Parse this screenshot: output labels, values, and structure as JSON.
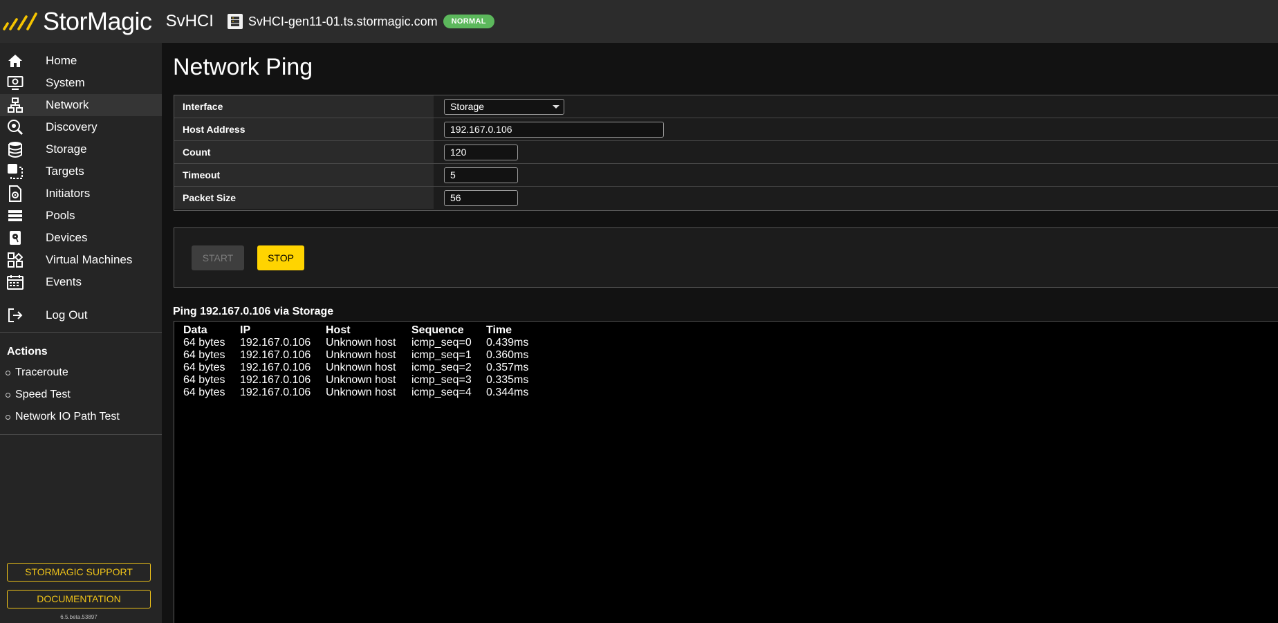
{
  "header": {
    "brand": "StorMagic",
    "product": "SvHCI",
    "hostname": "SvHCI-gen11-01.ts.stormagic.com",
    "status": "NORMAL"
  },
  "sidebar": {
    "items": [
      {
        "label": "Home",
        "icon": "home-icon"
      },
      {
        "label": "System",
        "icon": "system-icon"
      },
      {
        "label": "Network",
        "icon": "network-icon",
        "active": true
      },
      {
        "label": "Discovery",
        "icon": "discovery-icon"
      },
      {
        "label": "Storage",
        "icon": "storage-icon"
      },
      {
        "label": "Targets",
        "icon": "targets-icon"
      },
      {
        "label": "Initiators",
        "icon": "initiators-icon"
      },
      {
        "label": "Pools",
        "icon": "pools-icon"
      },
      {
        "label": "Devices",
        "icon": "devices-icon"
      },
      {
        "label": "Virtual Machines",
        "icon": "virtual-machines-icon"
      },
      {
        "label": "Events",
        "icon": "calendar-icon"
      }
    ],
    "logout": "Log Out",
    "actions_title": "Actions",
    "actions": [
      "Traceroute",
      "Speed Test",
      "Network IO Path Test"
    ],
    "support_button": "STORMAGIC SUPPORT",
    "docs_button": "DOCUMENTATION",
    "version": "6.5.beta.53897"
  },
  "main": {
    "title": "Network Ping",
    "form": {
      "interface_label": "Interface",
      "interface_value": "Storage",
      "host_label": "Host Address",
      "host_value": "192.167.0.106",
      "count_label": "Count",
      "count_value": "120",
      "timeout_label": "Timeout",
      "timeout_value": "5",
      "packet_label": "Packet Size",
      "packet_value": "56"
    },
    "start_button": "START",
    "stop_button": "STOP",
    "output_title": "Ping 192.167.0.106 via Storage",
    "output": {
      "columns": [
        "Data",
        "IP",
        "Host",
        "Sequence",
        "Time"
      ],
      "rows": [
        [
          "64 bytes",
          "192.167.0.106",
          "Unknown host",
          "icmp_seq=0",
          "0.439ms"
        ],
        [
          "64 bytes",
          "192.167.0.106",
          "Unknown host",
          "icmp_seq=1",
          "0.360ms"
        ],
        [
          "64 bytes",
          "192.167.0.106",
          "Unknown host",
          "icmp_seq=2",
          "0.357ms"
        ],
        [
          "64 bytes",
          "192.167.0.106",
          "Unknown host",
          "icmp_seq=3",
          "0.335ms"
        ],
        [
          "64 bytes",
          "192.167.0.106",
          "Unknown host",
          "icmp_seq=4",
          "0.344ms"
        ]
      ]
    }
  },
  "colors": {
    "accent": "#ffd400",
    "status_green": "#5cb85c",
    "sidebar_bg": "#252525",
    "header_bg": "#2c2c2c"
  }
}
